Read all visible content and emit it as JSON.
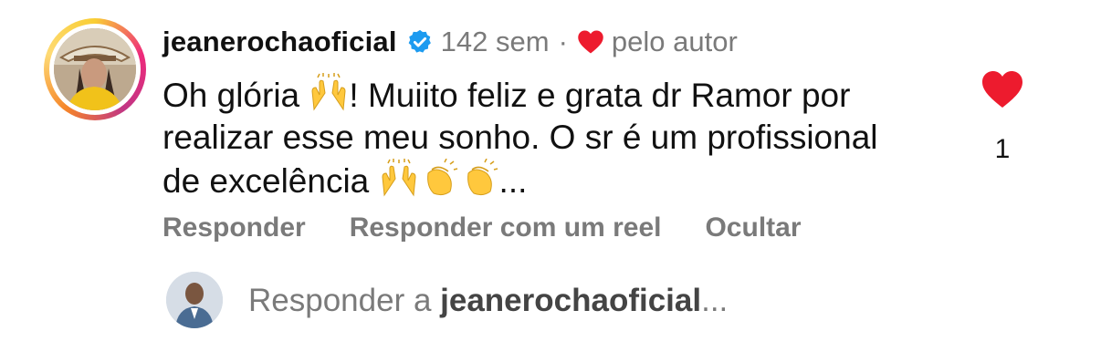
{
  "comment": {
    "username": "jeanerochaoficial",
    "time": "142 sem",
    "separator": "·",
    "liked_by_author": "pelo autor",
    "text_start": "Oh glória ",
    "text_mid": "! Muiito feliz e grata dr Ramor por realizar esse meu sonho. O sr é um profissional de excelência ",
    "text_end": "...",
    "emojis": [
      "raising-hands",
      "raising-hands",
      "clapping-hands",
      "clapping-hands"
    ],
    "like_count": "1"
  },
  "actions": {
    "reply": "Responder",
    "reply_reel": "Responder com um reel",
    "hide": "Ocultar"
  },
  "reply_bar": {
    "prefix": "Responder a ",
    "target": "jeanerochaoficial",
    "suffix": "..."
  },
  "colors": {
    "heart": "#ed1b2e",
    "verified": "#1d9bf0",
    "muted_text": "#7a7a7a"
  }
}
